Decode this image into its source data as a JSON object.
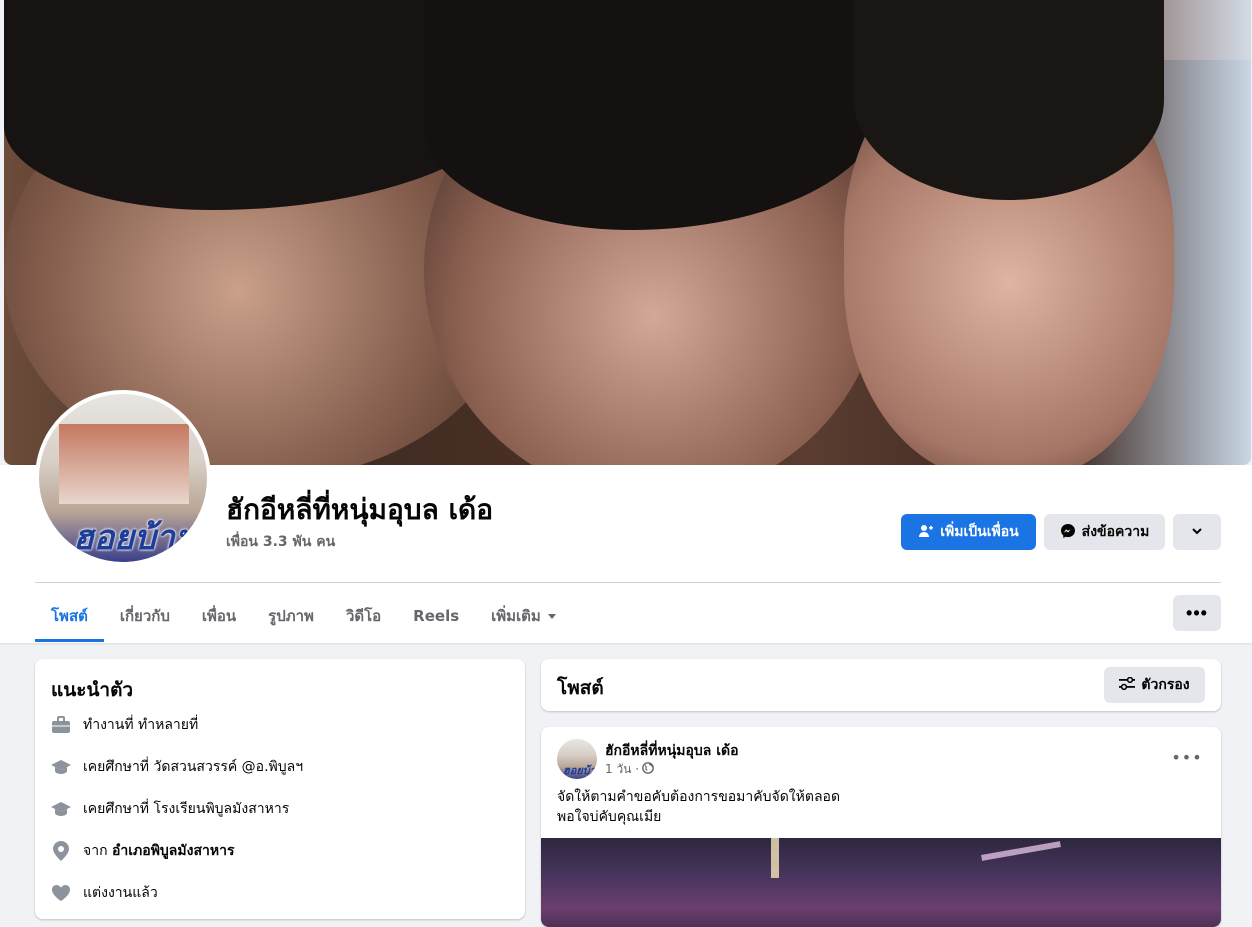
{
  "profile": {
    "name": "ฮักอีหลี่ที่หนุ่มอุบล เด้อ",
    "friends": "เพื่อน 3.3 พัน คน",
    "avatar_caption": "ฮอยบ้าน"
  },
  "actions": {
    "add_friend": "เพิ่มเป็นเพื่อน",
    "message": "ส่งข้อความ"
  },
  "tabs": [
    {
      "label": "โพสต์",
      "active": true
    },
    {
      "label": "เกี่ยวกับ"
    },
    {
      "label": "เพื่อน"
    },
    {
      "label": "รูปภาพ"
    },
    {
      "label": "วิดีโอ"
    },
    {
      "label": "Reels"
    },
    {
      "label": "เพิ่มเติม"
    }
  ],
  "intro": {
    "title": "แนะนำตัว",
    "items": [
      {
        "icon": "briefcase-icon",
        "prefix": "ทำงานที่ ทำหลายที่",
        "bold": ""
      },
      {
        "icon": "graduation-cap-icon",
        "prefix": "เคยศึกษาที่ วัดสวนสวรรค์ @อ.พิบูลฯ",
        "bold": ""
      },
      {
        "icon": "graduation-cap-icon",
        "prefix": "เคยศึกษาที่ โรงเรียนพิบูลมังสาหาร",
        "bold": ""
      },
      {
        "icon": "location-pin-icon",
        "prefix": "จาก ",
        "bold": "อำเภอพิบูลมังสาหาร"
      },
      {
        "icon": "heart-icon",
        "prefix": "แต่งงานแล้ว",
        "bold": ""
      }
    ]
  },
  "posts": {
    "title": "โพสต์",
    "filter_label": "ตัวกรอง"
  },
  "post": {
    "author": "ฮักอีหลี่ที่หนุ่มอุบล เด้อ",
    "time": "1 วัน ·",
    "privacy_icon": "globe-icon",
    "text_line1": "จัดให้ตามคำขอคับต้องการขอมาคับจัดให้ตลอด",
    "text_line2": "พอใจบ่คับคุณเมีย"
  },
  "colors": {
    "accent": "#1b74e4",
    "secondary_button": "#e4e6eb",
    "page_bg": "#f0f2f5"
  }
}
